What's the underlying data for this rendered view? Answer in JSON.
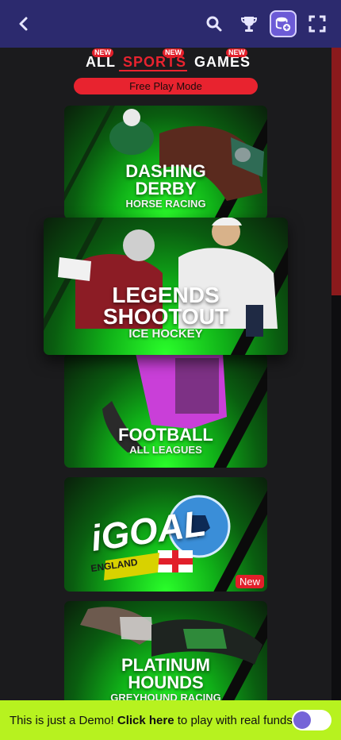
{
  "header": {
    "back_icon": "chevron-left-icon",
    "icons": [
      "search-icon",
      "trophy-icon",
      "wallet-add-icon",
      "fullscreen-icon"
    ],
    "colors": {
      "bar": "#2c2a6e",
      "wallet_button": "#6c5bd6"
    }
  },
  "tabs": {
    "items": [
      {
        "label": "ALL",
        "badge": "NEW",
        "active": false
      },
      {
        "label": "SPORTS",
        "badge": "NEW",
        "active": true
      },
      {
        "label": "GAMES",
        "badge": "NEW",
        "active": false
      }
    ],
    "active_color": "#e8232f"
  },
  "free_play_label": "Free Play Mode",
  "games": [
    {
      "title_line1": "DASHING",
      "title_line2": "DERBY",
      "subtitle": "HORSE RACING",
      "badge": ""
    },
    {
      "title_line1": "LEGENDS",
      "title_line2": "SHOOTOUT",
      "subtitle": "ICE HOCKEY",
      "badge": ""
    },
    {
      "title_line1": "FOOTBALL",
      "title_line2": "",
      "subtitle": "ALL LEAGUES",
      "badge": ""
    },
    {
      "title_line1": "iGOAL",
      "title_line2": "ENGLAND",
      "subtitle": "",
      "badge": "New"
    },
    {
      "title_line1": "PLATINUM",
      "title_line2": "HOUNDS",
      "subtitle": "GREYHOUND RACING",
      "badge": ""
    }
  ],
  "demo_bar": {
    "prefix": "This is just a Demo! ",
    "link": "Click here",
    "suffix": " to play with real funds.",
    "background": "#b7f21f",
    "toggle_on": false
  }
}
